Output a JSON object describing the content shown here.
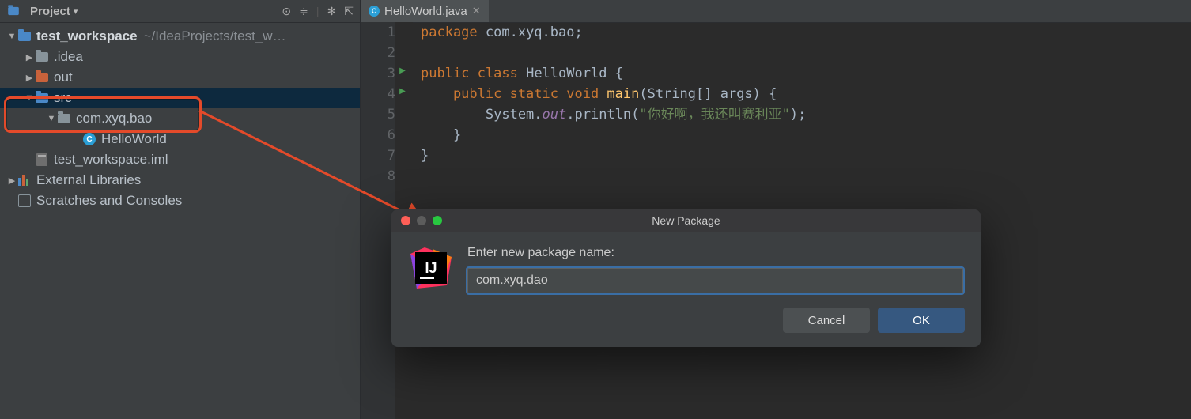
{
  "sidebar": {
    "panel_label": "Project",
    "dropdown_glyph": "▾",
    "root": {
      "name": "test_workspace",
      "path": "~/IdeaProjects/test_w…"
    },
    "items": [
      {
        "label": ".idea",
        "kind": "folder",
        "depth": 1,
        "arrow": "▶"
      },
      {
        "label": "out",
        "kind": "out",
        "depth": 1,
        "arrow": "▶"
      },
      {
        "label": "src",
        "kind": "src",
        "depth": 1,
        "arrow": "▼",
        "selected": true
      },
      {
        "label": "com.xyq.bao",
        "kind": "pkg",
        "depth": 2,
        "arrow": "▼"
      },
      {
        "label": "HelloWorld",
        "kind": "class",
        "depth": 3,
        "arrow": ""
      },
      {
        "label": "test_workspace.iml",
        "kind": "iml",
        "depth": 1,
        "arrow": ""
      },
      {
        "label": "External Libraries",
        "kind": "lib",
        "depth": 0,
        "arrow": "▶"
      },
      {
        "label": "Scratches and Consoles",
        "kind": "scratch",
        "depth": 0,
        "arrow": ""
      }
    ]
  },
  "editor": {
    "tab": {
      "filename": "HelloWorld.java"
    },
    "lines": [
      "1",
      "2",
      "3",
      "4",
      "5",
      "6",
      "7",
      "8"
    ],
    "code": {
      "l1_pkg": "package",
      "l1_rest": " com.xyq.bao;",
      "l3_pub": "public",
      "l3_cls": " class",
      "l3_name": " HelloWorld {",
      "l4_mod": "    public static",
      "l4_void": " void",
      "l4_main": " main",
      "l4_sig": "(String[] args) {",
      "l5_pre": "        System.",
      "l5_out": "out",
      "l5_dot": ".println(",
      "l5_str": "\"你好啊，我还叫赛利亚\"",
      "l5_end": ");",
      "l6": "    }",
      "l7": "}"
    }
  },
  "dialog": {
    "title": "New Package",
    "prompt": "Enter new package name:",
    "value": "com.xyq.dao",
    "cancel": "Cancel",
    "ok": "OK"
  }
}
